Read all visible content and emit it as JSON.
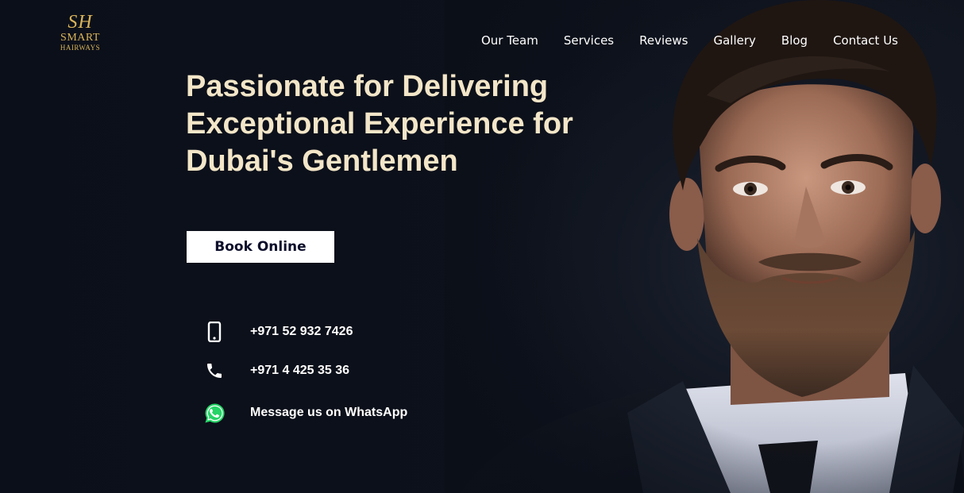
{
  "logo": {
    "mark": "SH",
    "line1": "SMART",
    "line2": "HAIRWAYS"
  },
  "nav": {
    "items": [
      {
        "label": "Our Team"
      },
      {
        "label": "Services"
      },
      {
        "label": "Reviews"
      },
      {
        "label": "Gallery"
      },
      {
        "label": "Blog"
      },
      {
        "label": "Contact Us"
      }
    ]
  },
  "hero": {
    "headline_line1": "Passionate for Delivering",
    "headline_line2": "Exceptional Experience for",
    "headline_line3": "Dubai's Gentlemen",
    "book_label": "Book Online"
  },
  "contacts": [
    {
      "icon": "mobile-phone-icon",
      "text": "+971 52 932 7426"
    },
    {
      "icon": "phone-handset-icon",
      "text": "+971 4 425 35 36"
    },
    {
      "icon": "whatsapp-icon",
      "text": "Message us on WhatsApp"
    }
  ],
  "colors": {
    "background": "#0b0f18",
    "headline": "#f3e6c8",
    "logo_gold": "#d9b45a",
    "whatsapp": "#25d366",
    "button_text": "#0d0f2b"
  }
}
